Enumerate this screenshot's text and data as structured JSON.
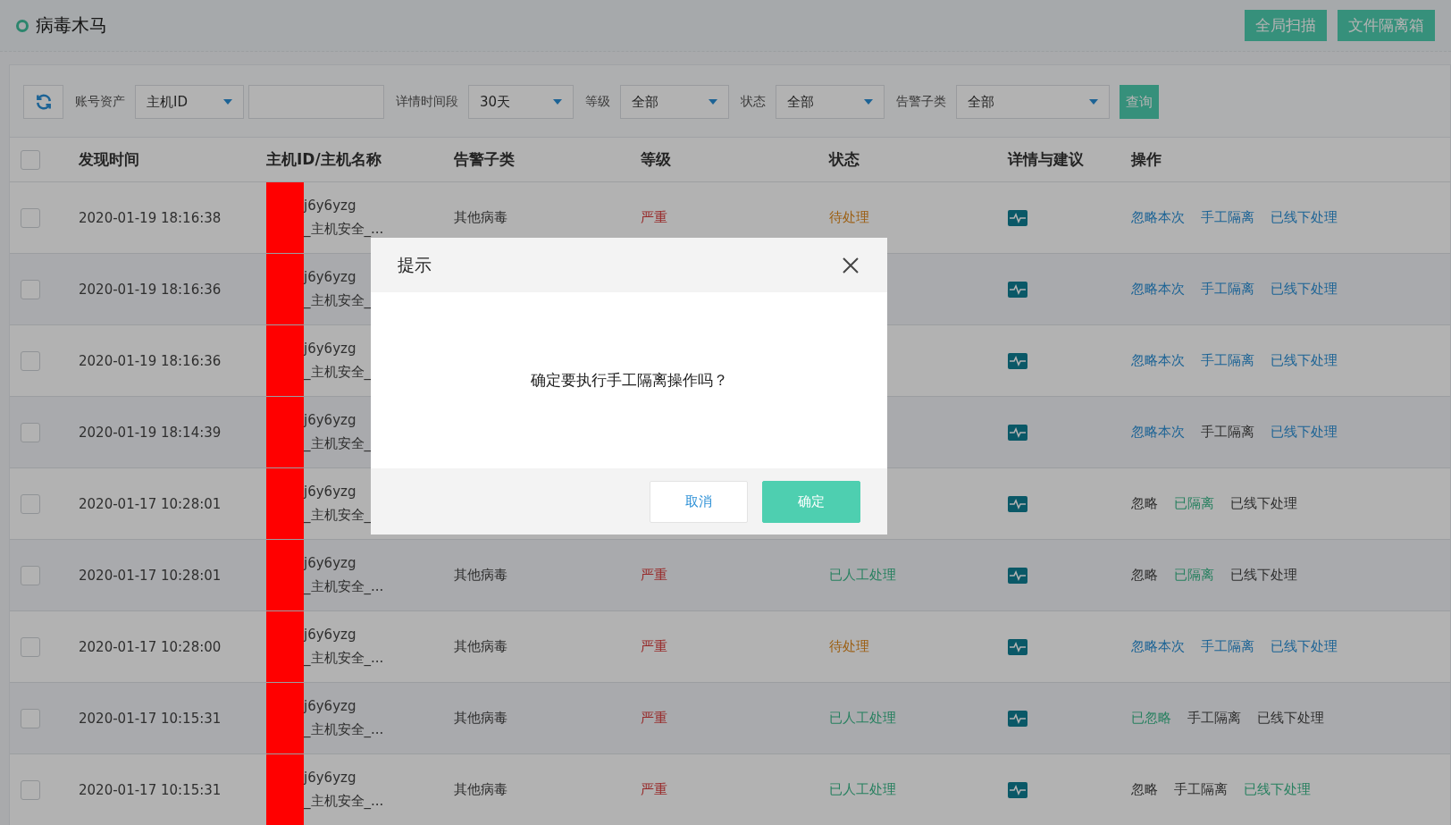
{
  "header": {
    "title": "病毒木马",
    "buttons": [
      "全局扫描",
      "文件隔离箱"
    ]
  },
  "filters": [
    {
      "kind": "refresh"
    },
    {
      "kind": "select",
      "label": "账号资产",
      "value": "主机ID"
    },
    {
      "kind": "input"
    },
    {
      "kind": "select",
      "label": "详情时间段",
      "value": "30天"
    },
    {
      "kind": "select",
      "label": "等级",
      "value": "全部"
    },
    {
      "kind": "select",
      "label": "状态",
      "value": "全部"
    },
    {
      "kind": "select",
      "label": "告警子类",
      "value": "全部"
    },
    {
      "kind": "button",
      "label": "查询"
    }
  ],
  "table": {
    "select_all": {
      "checked": false
    },
    "columns": [
      "发现时间",
      "主机ID/主机名称",
      "告警子类",
      "等级",
      "状态",
      "详情与建议",
      "操作"
    ],
    "rows": [
      {
        "checked": false,
        "time": "2020-01-19 18:16:38",
        "host": [
          "j6y6yzg",
          "_主机安全_..."
        ],
        "category": "其他病毒",
        "grade": "严重",
        "status": {
          "text": "待处理",
          "kind": "pending"
        },
        "actions": [
          {
            "text": "忽略本次",
            "kind": "link"
          },
          {
            "text": "手工隔离",
            "kind": "link"
          },
          {
            "text": "已线下处理",
            "kind": "link"
          }
        ]
      },
      {
        "checked": false,
        "time": "2020-01-19 18:16:36",
        "host": [
          "j6y6yzg",
          "_主机安全_"
        ],
        "actions": [
          {
            "text": "忽略本次",
            "kind": "link"
          },
          {
            "text": "手工隔离",
            "kind": "link"
          },
          {
            "text": "已线下处理",
            "kind": "link"
          }
        ]
      },
      {
        "checked": false,
        "time": "2020-01-19 18:16:36",
        "host": [
          "j6y6yzg",
          "_主机安全_"
        ],
        "actions": [
          {
            "text": "忽略本次",
            "kind": "link"
          },
          {
            "text": "手工隔离",
            "kind": "link"
          },
          {
            "text": "已线下处理",
            "kind": "link"
          }
        ]
      },
      {
        "checked": false,
        "time": "2020-01-19 18:14:39",
        "host": [
          "j6y6yzg",
          "_主机安全_"
        ],
        "actions": [
          {
            "text": "忽略本次",
            "kind": "link"
          },
          {
            "text": "手工隔离",
            "kind": "plain"
          },
          {
            "text": "已线下处理",
            "kind": "link"
          }
        ]
      },
      {
        "checked": false,
        "time": "2020-01-17 10:28:01",
        "host": [
          "j6y6yzg",
          "_主机安全_"
        ],
        "actions": [
          {
            "text": "忽略",
            "kind": "plain"
          },
          {
            "text": "已隔离",
            "kind": "done"
          },
          {
            "text": "已线下处理",
            "kind": "plain"
          }
        ]
      },
      {
        "checked": false,
        "time": "2020-01-17 10:28:01",
        "host": [
          "j6y6yzg",
          "_主机安全_..."
        ],
        "category": "其他病毒",
        "grade": "严重",
        "status": {
          "text": "已人工处理",
          "kind": "handled"
        },
        "actions": [
          {
            "text": "忽略",
            "kind": "plain"
          },
          {
            "text": "已隔离",
            "kind": "done"
          },
          {
            "text": "已线下处理",
            "kind": "plain"
          }
        ]
      },
      {
        "checked": false,
        "time": "2020-01-17 10:28:00",
        "host": [
          "j6y6yzg",
          "_主机安全_..."
        ],
        "category": "其他病毒",
        "grade": "严重",
        "status": {
          "text": "待处理",
          "kind": "pending"
        },
        "actions": [
          {
            "text": "忽略本次",
            "kind": "link"
          },
          {
            "text": "手工隔离",
            "kind": "link"
          },
          {
            "text": "已线下处理",
            "kind": "link"
          }
        ]
      },
      {
        "checked": false,
        "time": "2020-01-17 10:15:31",
        "host": [
          "j6y6yzg",
          "_主机安全_..."
        ],
        "category": "其他病毒",
        "grade": "严重",
        "status": {
          "text": "已人工处理",
          "kind": "handled"
        },
        "actions": [
          {
            "text": "已忽略",
            "kind": "done"
          },
          {
            "text": "手工隔离",
            "kind": "plain"
          },
          {
            "text": "已线下处理",
            "kind": "plain"
          }
        ]
      },
      {
        "checked": false,
        "time": "2020-01-17 10:15:31",
        "host": [
          "j6y6yzg",
          "_主机安全_..."
        ],
        "category": "其他病毒",
        "grade": "严重",
        "status": {
          "text": "已人工处理",
          "kind": "handled"
        },
        "actions": [
          {
            "text": "忽略",
            "kind": "plain"
          },
          {
            "text": "手工隔离",
            "kind": "plain"
          },
          {
            "text": "已线下处理",
            "kind": "done"
          }
        ]
      }
    ]
  },
  "dialog": {
    "title": "提示",
    "message": "确定要执行手工隔离操作吗？",
    "buttons": [
      {
        "text": "取消",
        "kind": "secondary"
      },
      {
        "text": "确定",
        "kind": "primary"
      }
    ]
  }
}
